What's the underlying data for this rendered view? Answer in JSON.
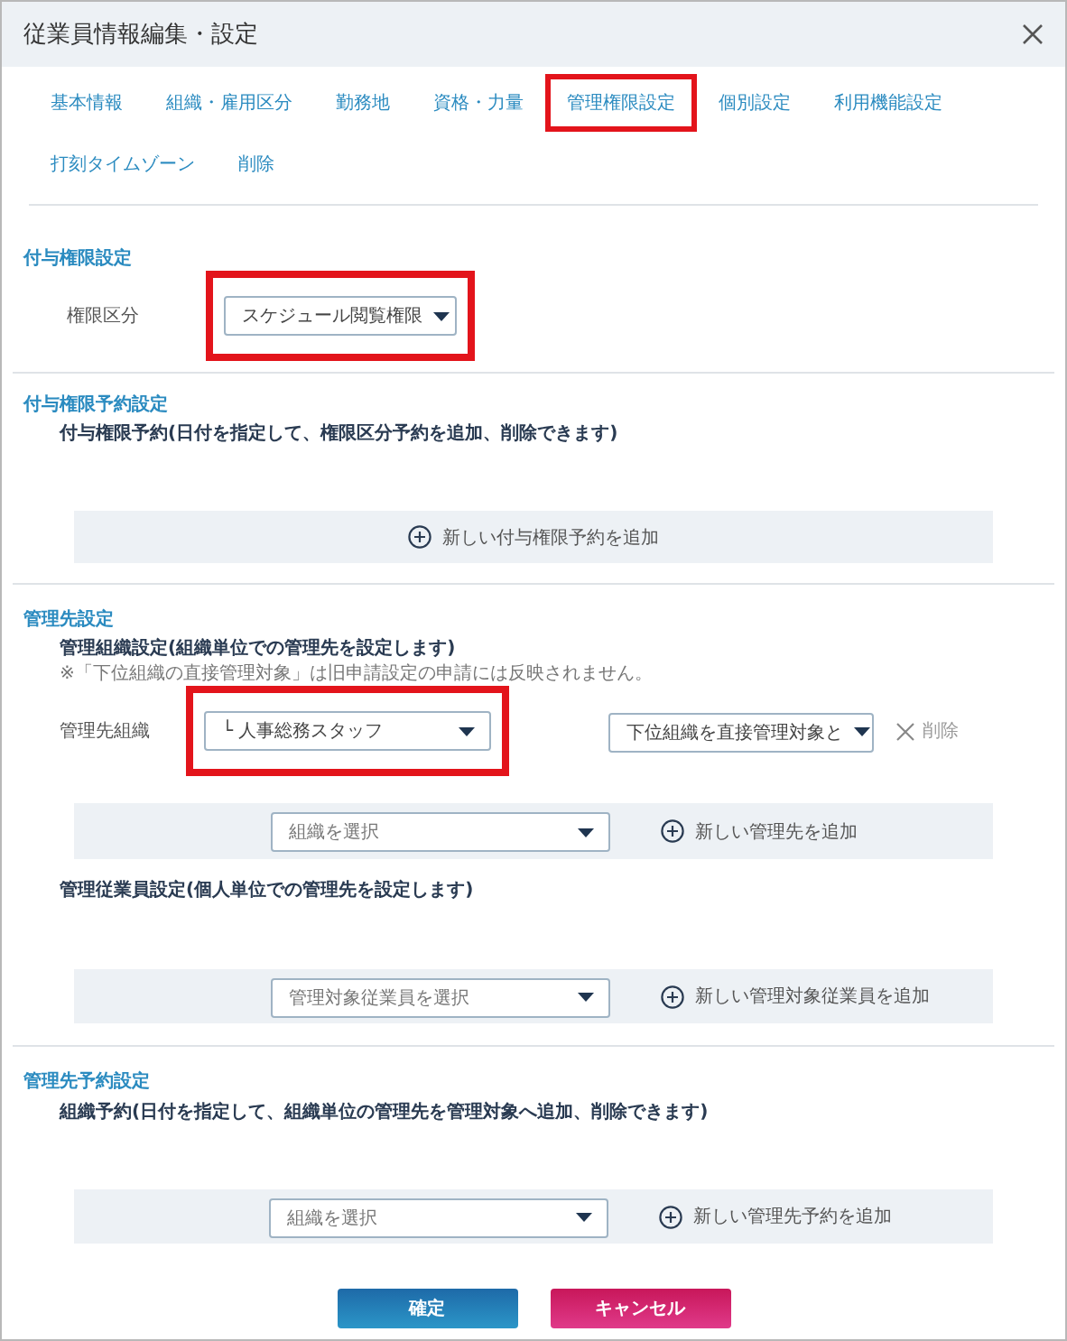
{
  "window": {
    "title": "従業員情報編集・設定"
  },
  "tabs": [
    {
      "label": "基本情報",
      "highlighted": false
    },
    {
      "label": "組織・雇用区分",
      "highlighted": false
    },
    {
      "label": "勤務地",
      "highlighted": false
    },
    {
      "label": "資格・力量",
      "highlighted": false
    },
    {
      "label": "管理権限設定",
      "highlighted": true
    },
    {
      "label": "個別設定",
      "highlighted": false
    },
    {
      "label": "利用機能設定",
      "highlighted": false
    },
    {
      "label": "打刻タイムゾーン",
      "highlighted": false
    },
    {
      "label": "削除",
      "highlighted": false
    }
  ],
  "grant_permission": {
    "title": "付与権限設定",
    "label": "権限区分",
    "select": {
      "value": "スケジュール閲覧権限",
      "highlighted": true
    }
  },
  "grant_reservation": {
    "title": "付与権限予約設定",
    "subtitle": "付与権限予約(日付を指定して、権限区分予約を追加、削除できます)",
    "add_button": "新しい付与権限予約を追加"
  },
  "management": {
    "title": "管理先設定",
    "org_subtitle": "管理組織設定(組織単位での管理先を設定します)",
    "note": "※「下位組織の直接管理対象」は旧申請設定の申請には反映されません。",
    "org_row": {
      "label": "管理先組織",
      "select": {
        "value": "└ 人事総務スタッフ",
        "highlighted": true
      },
      "scope_select": {
        "value": "下位組織を直接管理対象と",
        "highlighted": false
      },
      "delete": "削除"
    },
    "org_add": {
      "placeholder": "組織を選択",
      "add_button": "新しい管理先を追加"
    },
    "employee_subtitle": "管理従業員設定(個人単位での管理先を設定します)",
    "employee_add": {
      "placeholder": "管理対象従業員を選択",
      "add_button": "新しい管理対象従業員を追加"
    }
  },
  "reservation": {
    "title": "管理先予約設定",
    "subtitle": "組織予約(日付を指定して、組織単位の管理先を管理対象へ追加、削除できます)",
    "add": {
      "placeholder": "組織を選択",
      "add_button": "新しい管理先予約を追加"
    }
  },
  "buttons": [
    {
      "label": "確定",
      "kind": "confirm"
    },
    {
      "label": "キャンセル",
      "kind": "cancel"
    }
  ]
}
